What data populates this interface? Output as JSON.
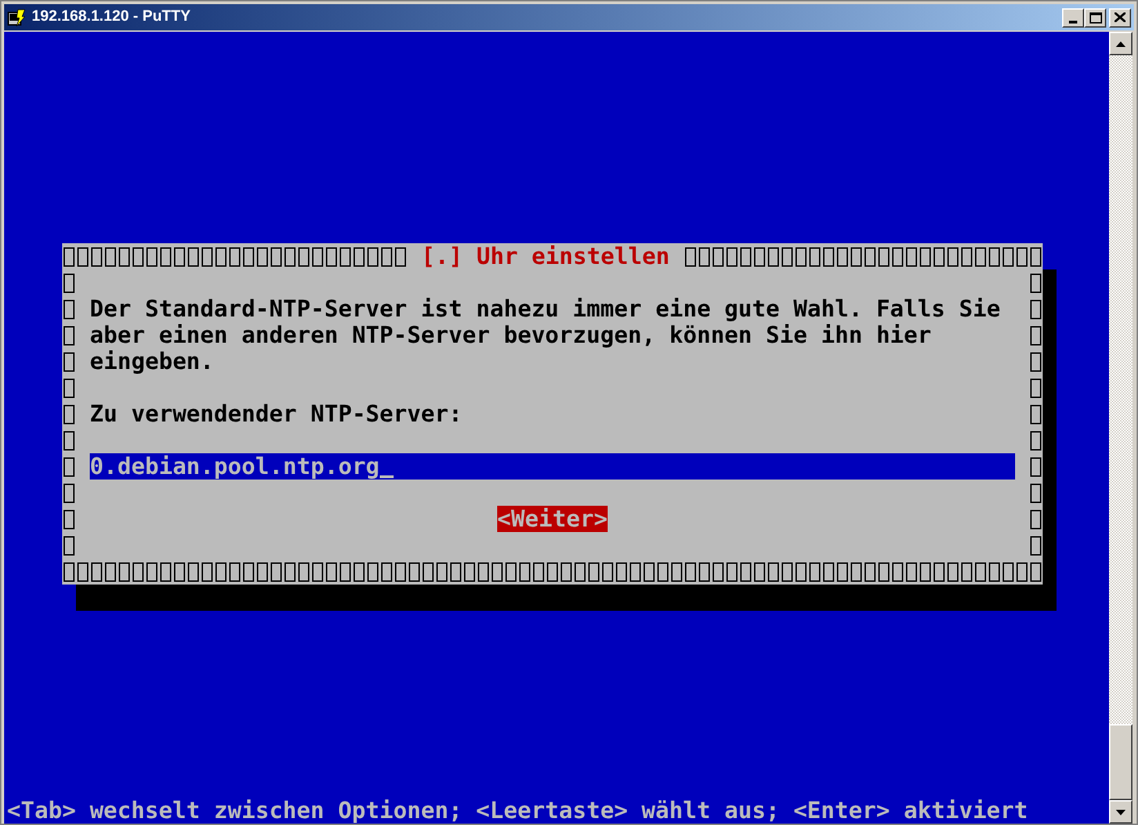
{
  "window": {
    "title": "192.168.1.120 - PuTTY"
  },
  "dialog": {
    "title": "[.] Uhr einstellen",
    "description": "Der Standard-NTP-Server ist nahezu immer eine gute Wahl. Falls Sie aber einen anderen NTP-Server bevorzugen, können Sie ihn hier eingeben.",
    "field_label": "Zu verwendender NTP-Server:",
    "field": {
      "value": "0.debian.pool.ntp.org"
    },
    "buttons": [
      {
        "label": "<Weiter>",
        "selected": true
      }
    ]
  },
  "status_line": "<Tab> wechselt zwischen Optionen; <Leertaste> wählt aus; <Enter> aktiviert"
}
